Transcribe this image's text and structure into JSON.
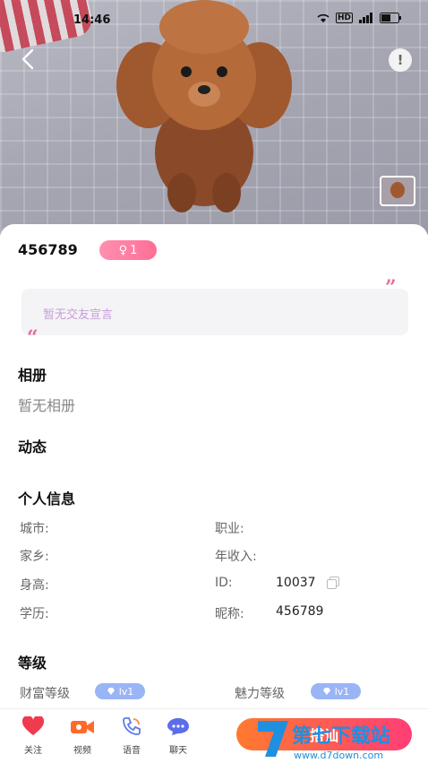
{
  "status_bar": {
    "time": "14:46",
    "network": "HD"
  },
  "profile": {
    "nickname": "456789",
    "gender_symbol": "♀",
    "age": "1",
    "motto_placeholder": "暂无交友宣言"
  },
  "album": {
    "title": "相册",
    "empty_text": "暂无相册"
  },
  "moments": {
    "title": "动态"
  },
  "personal_info": {
    "title": "个人信息",
    "fields": [
      {
        "label": "城市:",
        "value": ""
      },
      {
        "label": "职业:",
        "value": ""
      },
      {
        "label": "家乡:",
        "value": ""
      },
      {
        "label": "年收入:",
        "value": ""
      },
      {
        "label": "身高:",
        "value": ""
      },
      {
        "label": "ID:",
        "value": "10037"
      },
      {
        "label": "学历:",
        "value": ""
      },
      {
        "label": "昵称:",
        "value": "456789"
      }
    ]
  },
  "level": {
    "title": "等级",
    "wealth_label": "财富等级",
    "wealth_badge": "lv1",
    "charm_label": "魅力等级",
    "charm_badge": "lv1"
  },
  "bottom_bar": {
    "tabs": [
      {
        "label": "关注",
        "icon": "heart-icon"
      },
      {
        "label": "视频",
        "icon": "video-camera-icon"
      },
      {
        "label": "语音",
        "icon": "phone-icon"
      },
      {
        "label": "聊天",
        "icon": "chat-bubble-icon"
      }
    ],
    "chat_button_label": "搭讪"
  },
  "watermark": {
    "text": "第七下载站",
    "url_text": "www.d7down.com"
  },
  "colors": {
    "accent_pink": "#ff6f95",
    "accent_orange": "#ff7a2f",
    "level_blue": "#9ab5f5"
  }
}
